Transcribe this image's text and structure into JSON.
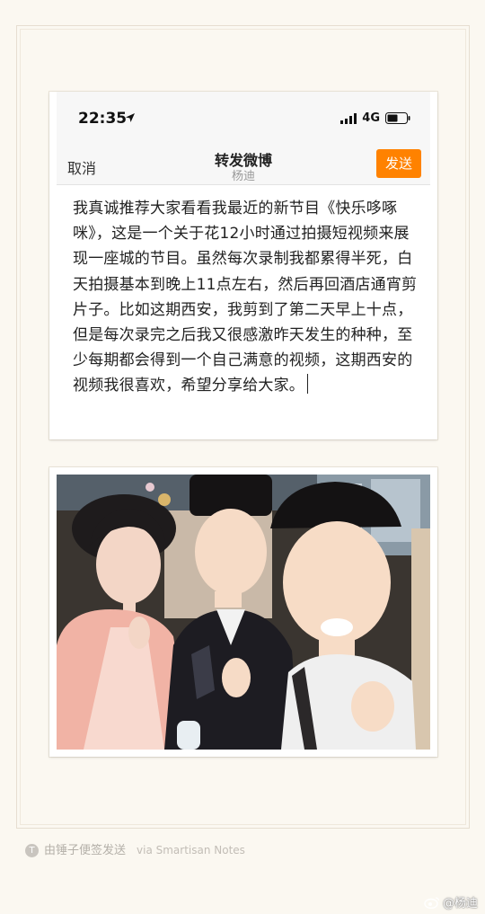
{
  "status": {
    "time": "22:35",
    "network": "4G"
  },
  "nav": {
    "cancel": "取消",
    "title": "转发微博",
    "subtitle": "杨迪",
    "send": "发送"
  },
  "post": {
    "text": "我真诚推荐大家看看我最近的新节目《快乐哆啄咪》，这是一个关于花12小时通过拍摄短视频来展现一座城的节目。虽然每次录制我都累得半死，白天拍摄基本到晚上11点左右，然后再回酒店通宵剪片子。比如这期西安，我剪到了第二天早上十点，但是每次录完之后我又很感激昨天发生的种种，至少每期都会得到一个自己满意的视频，这期西安的视频我很喜欢，希望分享给大家。"
  },
  "footer": {
    "icon_letter": "T",
    "text": "由锤子便签发送",
    "via": "via Smartisan Notes"
  },
  "watermark": "@杨迪",
  "colors": {
    "accent": "#ff8200",
    "background": "#fbf8f1"
  }
}
